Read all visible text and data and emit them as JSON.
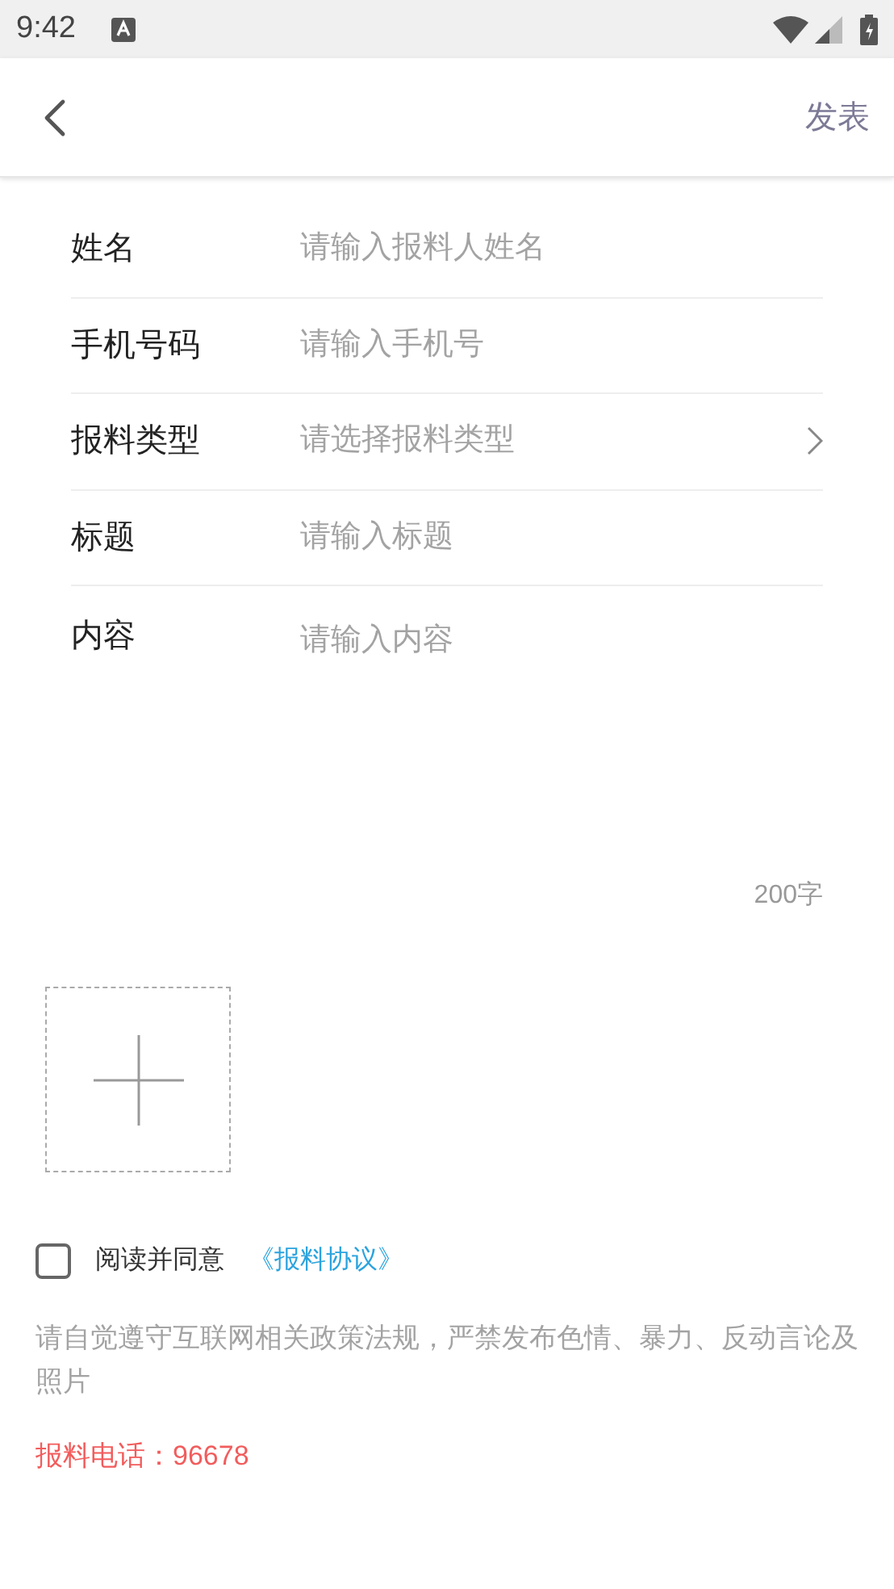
{
  "status_bar": {
    "time": "9:42"
  },
  "nav": {
    "action": "发表"
  },
  "fields": [
    {
      "label": "姓名",
      "placeholder": "请输入报料人姓名",
      "kind": "input"
    },
    {
      "label": "手机号码",
      "placeholder": "请输入手机号",
      "kind": "input"
    },
    {
      "label": "报料类型",
      "placeholder": "请选择报料类型",
      "kind": "select"
    },
    {
      "label": "标题",
      "placeholder": "请输入标题",
      "kind": "input"
    },
    {
      "label": "内容",
      "placeholder": "请输入内容",
      "kind": "textarea"
    }
  ],
  "char_limit": "200字",
  "agreement": {
    "checked": false,
    "text": "阅读并同意",
    "link": "《报料协议》"
  },
  "notice": "请自觉遵守互联网相关政策法规，严禁发布色情、暴力、反动言论及照片",
  "hotline": "报料电话：96678"
}
